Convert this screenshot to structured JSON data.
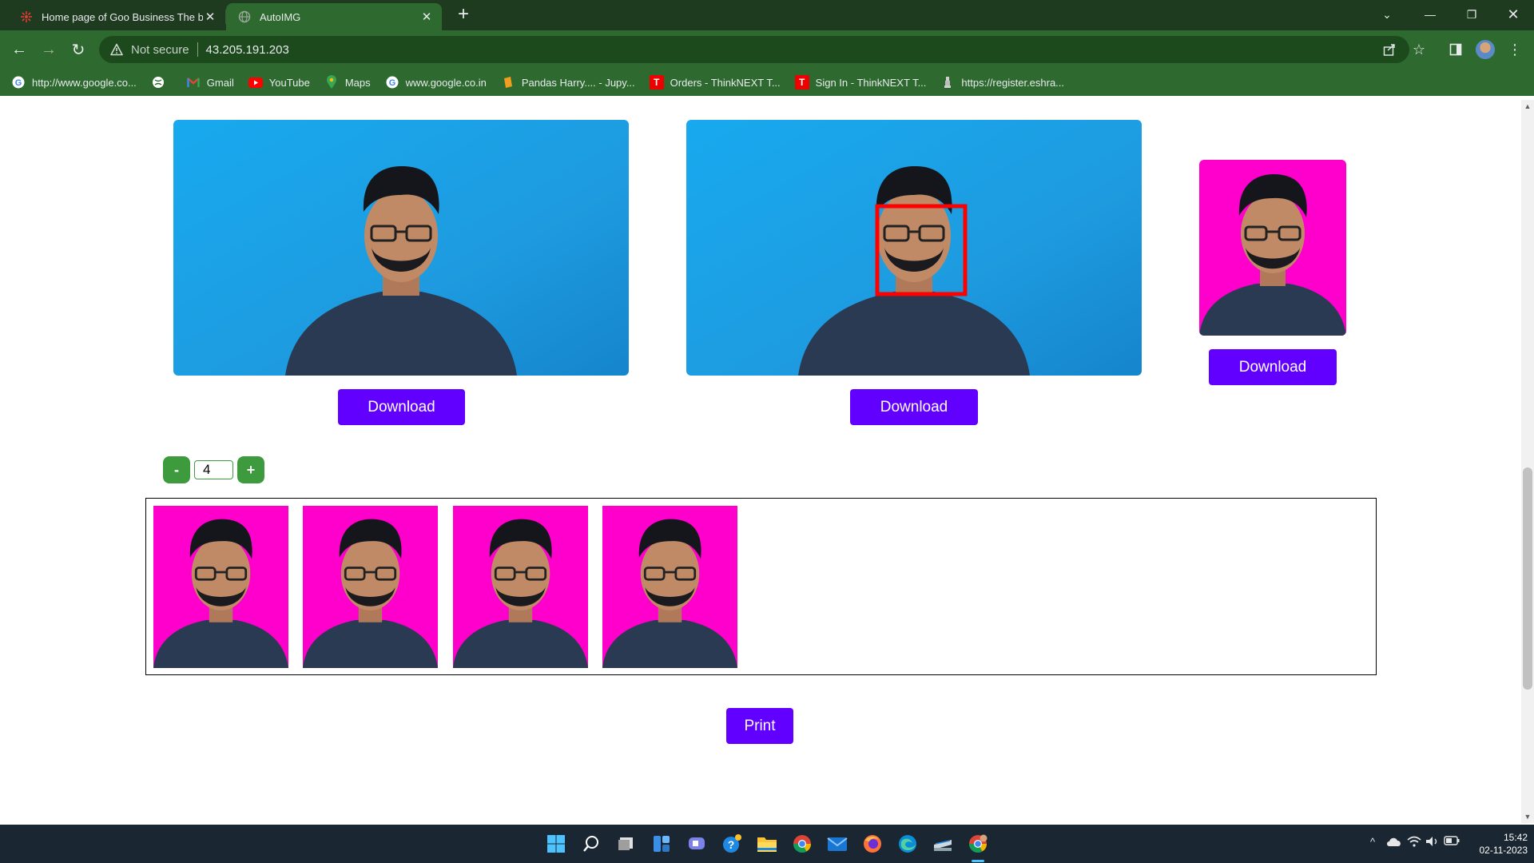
{
  "browser": {
    "tabs": [
      {
        "title": "Home page of Goo Business The be",
        "active": false
      },
      {
        "title": "AutoIMG",
        "active": true
      }
    ],
    "address": {
      "security_label": "Not secure",
      "url": "43.205.191.203"
    },
    "bookmarks": [
      {
        "label": "http://www.google.co...",
        "icon": "google-icon"
      },
      {
        "label": "",
        "icon": "globe-icon"
      },
      {
        "label": "Gmail",
        "icon": "gmail-icon"
      },
      {
        "label": "YouTube",
        "icon": "youtube-icon"
      },
      {
        "label": "Maps",
        "icon": "maps-icon"
      },
      {
        "label": "www.google.co.in",
        "icon": "google-icon"
      },
      {
        "label": "Pandas Harry.... - Jupy...",
        "icon": "jupyter-icon"
      },
      {
        "label": "Orders - ThinkNEXT T...",
        "icon": "thinknext-icon"
      },
      {
        "label": "Sign In - ThinkNEXT T...",
        "icon": "thinknext-icon"
      },
      {
        "label": "https://register.eshra...",
        "icon": "emblem-icon"
      }
    ]
  },
  "page": {
    "original": {
      "download_label": "Download"
    },
    "detected": {
      "download_label": "Download"
    },
    "passport": {
      "download_label": "Download"
    },
    "counter": {
      "minus_label": "-",
      "value": "4",
      "plus_label": "+"
    },
    "copies_count": 4,
    "print_label": "Print"
  },
  "colors": {
    "accent_button": "#6200ff",
    "counter_button": "#3d9b3d",
    "photo_background": "#1ea6ec",
    "passport_background": "#ff00cc",
    "face_box": "#ff0000",
    "chrome_frame": "#2e6a2f"
  },
  "taskbar": {
    "icons": [
      "windows-start-icon",
      "search-icon",
      "task-view-icon",
      "widgets-icon",
      "teams-chat-icon",
      "help-icon",
      "file-explorer-icon",
      "chrome-icon",
      "mail-icon",
      "firefox-icon",
      "edge-icon",
      "scanner-icon",
      "chrome-active-icon"
    ],
    "time": "15:42",
    "date": "02-11-2023"
  }
}
